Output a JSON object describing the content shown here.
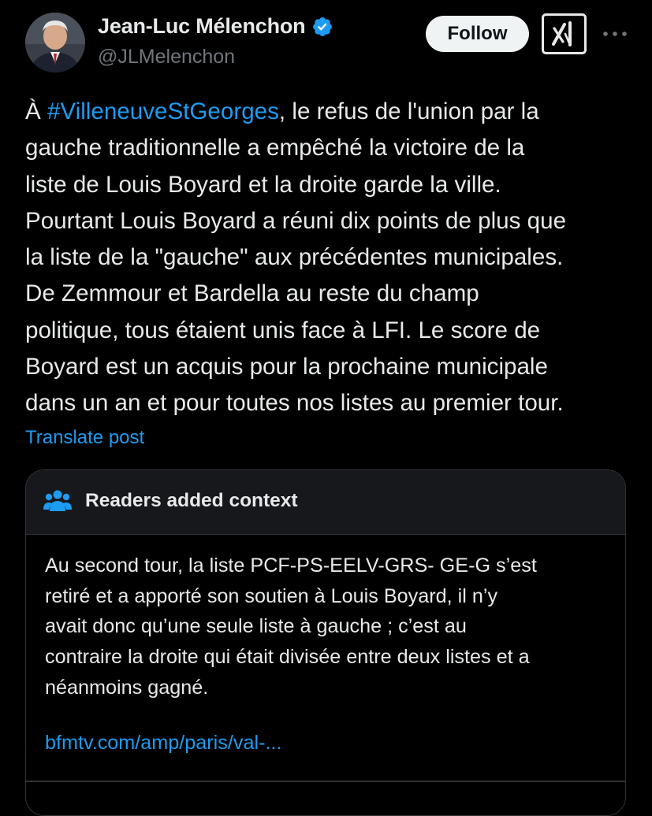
{
  "author": {
    "display_name": "Jean-Luc Mélenchon",
    "handle": "@JLMelenchon",
    "verified": true,
    "avatar_icon": "profile-photo"
  },
  "actions": {
    "follow_label": "Follow",
    "grok_icon": "grok-icon",
    "more_icon": "more-dots-icon"
  },
  "tweet": {
    "hashtag": "#VilleneuveStGeorges",
    "lines": [
      "À ",
      "gauche traditionnelle a empêché la victoire de la",
      "liste de Louis Boyard et la droite garde la ville.",
      "Pourtant Louis Boyard a réuni dix points de plus que",
      "la liste de la \"gauche\" aux précédentes municipales.",
      "De Zemmour et Bardella au reste du champ",
      "politique, tous étaient unis face à LFI. Le score de",
      "Boyard est un acquis pour la prochaine municipale",
      "dans un an et pour toutes nos listes au premier tour."
    ],
    "line1_suffix": ", le refus de l'union par la",
    "translate_label": "Translate post"
  },
  "community_note": {
    "title": "Readers added context",
    "icon": "people-icon",
    "lines": [
      "Au second tour, la liste PCF-PS-EELV-GRS- GE-G s’est",
      "retiré et a apporté son soutien à Louis Boyard, il n’y",
      "avait donc qu’une seule liste à gauche ; c’est au",
      "contraire la droite qui était divisée entre deux listes et a",
      "néanmoins gagné."
    ],
    "link": "bfmtv.com/amp/paris/val-..."
  },
  "colors": {
    "background": "#000000",
    "text": "#e7e9ea",
    "secondary_text": "#71767b",
    "accent": "#1d9bf0",
    "border": "#2f3336",
    "card_header": "#16181c"
  }
}
